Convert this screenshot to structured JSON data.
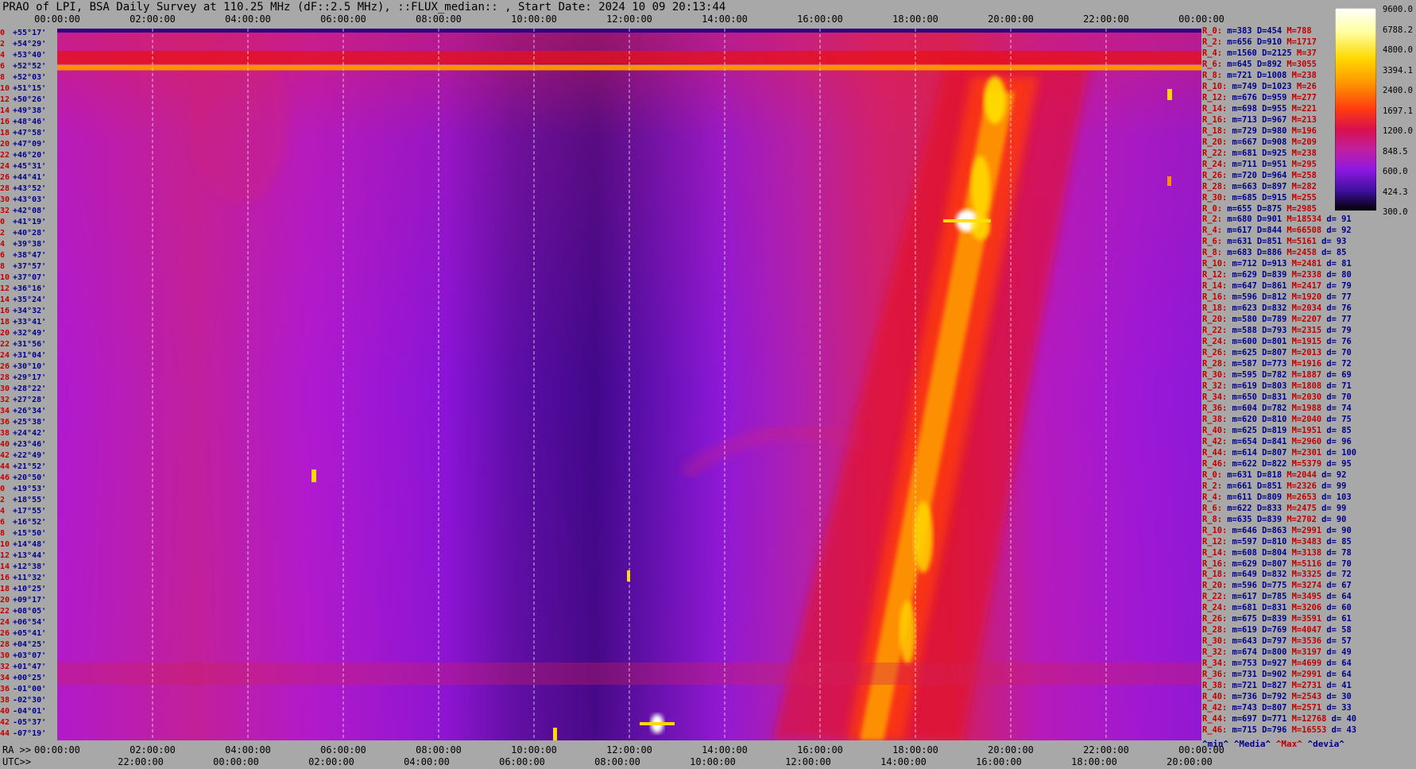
{
  "title": "PRAO of LPI, BSA Daily Survey at 110.25 MHz (dF::2.5 MHz), ::FLUX_median:: , Start Date: 2024 10 09 20:13:44",
  "chart_data": {
    "type": "heatmap",
    "title": "PRAO of LPI, BSA Daily Survey at 110.25 MHz (dF::2.5 MHz), ::FLUX_median:: , Start Date: 2024 10 09 20:13:44",
    "x_top_ticks": [
      "00:00:00",
      "02:00:00",
      "04:00:00",
      "06:00:00",
      "08:00:00",
      "10:00:00",
      "12:00:00",
      "14:00:00",
      "16:00:00",
      "18:00:00",
      "20:00:00",
      "22:00:00",
      "00:00:00"
    ],
    "x_bottom_ra_label": "RA >>",
    "x_bottom_ra_ticks": [
      "00:00:00",
      "02:00:00",
      "04:00:00",
      "06:00:00",
      "08:00:00",
      "10:00:00",
      "12:00:00",
      "14:00:00",
      "16:00:00",
      "18:00:00",
      "20:00:00",
      "22:00:00",
      "00:00:00"
    ],
    "x_bottom_utc_label": "UTC>>",
    "x_bottom_utc_ticks": [
      "22:00:00",
      "00:00:00",
      "02:00:00",
      "04:00:00",
      "06:00:00",
      "08:00:00",
      "10:00:00",
      "12:00:00",
      "14:00:00",
      "16:00:00",
      "18:00:00",
      "20:00:00"
    ],
    "y_rows": [
      {
        "n": "0",
        "dec": "+55°17'"
      },
      {
        "n": "2",
        "dec": "+54°29'"
      },
      {
        "n": "4",
        "dec": "+53°40'"
      },
      {
        "n": "6",
        "dec": "+52°52'"
      },
      {
        "n": "8",
        "dec": "+52°03'"
      },
      {
        "n": "10",
        "dec": "+51°15'"
      },
      {
        "n": "12",
        "dec": "+50°26'"
      },
      {
        "n": "14",
        "dec": "+49°38'"
      },
      {
        "n": "16",
        "dec": "+48°46'"
      },
      {
        "n": "18",
        "dec": "+47°58'"
      },
      {
        "n": "20",
        "dec": "+47°09'"
      },
      {
        "n": "22",
        "dec": "+46°20'"
      },
      {
        "n": "24",
        "dec": "+45°31'"
      },
      {
        "n": "26",
        "dec": "+44°41'"
      },
      {
        "n": "28",
        "dec": "+43°52'"
      },
      {
        "n": "30",
        "dec": "+43°03'"
      },
      {
        "n": "32",
        "dec": "+42°08'"
      },
      {
        "n": "0",
        "dec": "+41°19'"
      },
      {
        "n": "2",
        "dec": "+40°28'"
      },
      {
        "n": "4",
        "dec": "+39°38'"
      },
      {
        "n": "6",
        "dec": "+38°47'"
      },
      {
        "n": "8",
        "dec": "+37°57'"
      },
      {
        "n": "10",
        "dec": "+37°07'"
      },
      {
        "n": "12",
        "dec": "+36°16'"
      },
      {
        "n": "14",
        "dec": "+35°24'"
      },
      {
        "n": "16",
        "dec": "+34°32'"
      },
      {
        "n": "18",
        "dec": "+33°41'"
      },
      {
        "n": "20",
        "dec": "+32°49'"
      },
      {
        "n": "22",
        "dec": "+31°56'"
      },
      {
        "n": "24",
        "dec": "+31°04'"
      },
      {
        "n": "26",
        "dec": "+30°10'"
      },
      {
        "n": "28",
        "dec": "+29°17'"
      },
      {
        "n": "30",
        "dec": "+28°22'"
      },
      {
        "n": "32",
        "dec": "+27°28'"
      },
      {
        "n": "34",
        "dec": "+26°34'"
      },
      {
        "n": "36",
        "dec": "+25°38'"
      },
      {
        "n": "38",
        "dec": "+24°42'"
      },
      {
        "n": "40",
        "dec": "+23°46'"
      },
      {
        "n": "42",
        "dec": "+22°49'"
      },
      {
        "n": "44",
        "dec": "+21°52'"
      },
      {
        "n": "46",
        "dec": "+20°50'"
      },
      {
        "n": "0",
        "dec": "+19°53'"
      },
      {
        "n": "2",
        "dec": "+18°55'"
      },
      {
        "n": "4",
        "dec": "+17°55'"
      },
      {
        "n": "6",
        "dec": "+16°52'"
      },
      {
        "n": "8",
        "dec": "+15°50'"
      },
      {
        "n": "10",
        "dec": "+14°48'"
      },
      {
        "n": "12",
        "dec": "+13°44'"
      },
      {
        "n": "14",
        "dec": "+12°38'"
      },
      {
        "n": "16",
        "dec": "+11°32'"
      },
      {
        "n": "18",
        "dec": "+10°25'"
      },
      {
        "n": "20",
        "dec": "+09°17'"
      },
      {
        "n": "22",
        "dec": "+08°05'"
      },
      {
        "n": "24",
        "dec": "+06°54'"
      },
      {
        "n": "26",
        "dec": "+05°41'"
      },
      {
        "n": "28",
        "dec": "+04°25'"
      },
      {
        "n": "30",
        "dec": "+03°07'"
      },
      {
        "n": "32",
        "dec": "+01°47'"
      },
      {
        "n": "34",
        "dec": "+00°25'"
      },
      {
        "n": "36",
        "dec": "-01°00'"
      },
      {
        "n": "38",
        "dec": "-02°30'"
      },
      {
        "n": "40",
        "dec": "-04°01'"
      },
      {
        "n": "42",
        "dec": "-05°37'"
      },
      {
        "n": "44",
        "dec": "-07°19'"
      }
    ],
    "colorbar": {
      "ticks": [
        "9600.0",
        "6788.2",
        "4800.0",
        "3394.1",
        "2400.0",
        "1697.1",
        "1200.0",
        "848.5",
        "600.0",
        "424.3",
        "300.0"
      ],
      "colors": [
        "#ffffff",
        "#ffffa0",
        "#ffe000",
        "#ffa000",
        "#ff5000",
        "#e8101a",
        "#d0207a",
        "#a820d0",
        "#6a10e0",
        "#300080",
        "#000000"
      ]
    },
    "row_stats": [
      {
        "r": "R_0:",
        "m": "m=383",
        "d": "D=454",
        "x": "M=788",
        "dd": ""
      },
      {
        "r": "R_2:",
        "m": "m=656",
        "d": "D=910",
        "x": "M=1717",
        "dd": ""
      },
      {
        "r": "R_4:",
        "m": "m=1560",
        "d": "D=2125",
        "x": "M=37",
        "dd": ""
      },
      {
        "r": "R_6:",
        "m": "m=645",
        "d": "D=892",
        "x": "M=3055",
        "dd": ""
      },
      {
        "r": "R_8:",
        "m": "m=721",
        "d": "D=1008",
        "x": "M=238",
        "dd": ""
      },
      {
        "r": "R_10:",
        "m": "m=749",
        "d": "D=1023",
        "x": "M=26",
        "dd": ""
      },
      {
        "r": "R_12:",
        "m": "m=676",
        "d": "D=959",
        "x": "M=277",
        "dd": ""
      },
      {
        "r": "R_14:",
        "m": "m=698",
        "d": "D=955",
        "x": "M=221",
        "dd": ""
      },
      {
        "r": "R_16:",
        "m": "m=713",
        "d": "D=967",
        "x": "M=213",
        "dd": ""
      },
      {
        "r": "R_18:",
        "m": "m=729",
        "d": "D=980",
        "x": "M=196",
        "dd": ""
      },
      {
        "r": "R_20:",
        "m": "m=667",
        "d": "D=908",
        "x": "M=209",
        "dd": ""
      },
      {
        "r": "R_22:",
        "m": "m=681",
        "d": "D=925",
        "x": "M=238",
        "dd": ""
      },
      {
        "r": "R_24:",
        "m": "m=711",
        "d": "D=951",
        "x": "M=295",
        "dd": ""
      },
      {
        "r": "R_26:",
        "m": "m=720",
        "d": "D=964",
        "x": "M=258",
        "dd": ""
      },
      {
        "r": "R_28:",
        "m": "m=663",
        "d": "D=897",
        "x": "M=282",
        "dd": ""
      },
      {
        "r": "R_30:",
        "m": "m=685",
        "d": "D=915",
        "x": "M=255",
        "dd": ""
      },
      {
        "r": "R_0:",
        "m": "m=655",
        "d": "D=875",
        "x": "M=2985",
        "dd": ""
      },
      {
        "r": "R_2:",
        "m": "m=680",
        "d": "D=901",
        "x": "M=18534",
        "dd": "d= 91"
      },
      {
        "r": "R_4:",
        "m": "m=617",
        "d": "D=844",
        "x": "M=66508",
        "dd": "d= 92"
      },
      {
        "r": "R_6:",
        "m": "m=631",
        "d": "D=851",
        "x": "M=5161",
        "dd": "d= 93"
      },
      {
        "r": "R_8:",
        "m": "m=683",
        "d": "D=886",
        "x": "M=2458",
        "dd": "d= 85"
      },
      {
        "r": "R_10:",
        "m": "m=712",
        "d": "D=913",
        "x": "M=2481",
        "dd": "d= 81"
      },
      {
        "r": "R_12:",
        "m": "m=629",
        "d": "D=839",
        "x": "M=2338",
        "dd": "d= 80"
      },
      {
        "r": "R_14:",
        "m": "m=647",
        "d": "D=861",
        "x": "M=2417",
        "dd": "d= 79"
      },
      {
        "r": "R_16:",
        "m": "m=596",
        "d": "D=812",
        "x": "M=1920",
        "dd": "d= 77"
      },
      {
        "r": "R_18:",
        "m": "m=623",
        "d": "D=832",
        "x": "M=2034",
        "dd": "d= 76"
      },
      {
        "r": "R_20:",
        "m": "m=580",
        "d": "D=789",
        "x": "M=2207",
        "dd": "d= 77"
      },
      {
        "r": "R_22:",
        "m": "m=588",
        "d": "D=793",
        "x": "M=2315",
        "dd": "d= 79"
      },
      {
        "r": "R_24:",
        "m": "m=600",
        "d": "D=801",
        "x": "M=1915",
        "dd": "d= 76"
      },
      {
        "r": "R_26:",
        "m": "m=625",
        "d": "D=807",
        "x": "M=2013",
        "dd": "d= 70"
      },
      {
        "r": "R_28:",
        "m": "m=587",
        "d": "D=773",
        "x": "M=1916",
        "dd": "d= 72"
      },
      {
        "r": "R_30:",
        "m": "m=595",
        "d": "D=782",
        "x": "M=1887",
        "dd": "d= 69"
      },
      {
        "r": "R_32:",
        "m": "m=619",
        "d": "D=803",
        "x": "M=1808",
        "dd": "d= 71"
      },
      {
        "r": "R_34:",
        "m": "m=650",
        "d": "D=831",
        "x": "M=2030",
        "dd": "d= 70"
      },
      {
        "r": "R_36:",
        "m": "m=604",
        "d": "D=782",
        "x": "M=1988",
        "dd": "d= 74"
      },
      {
        "r": "R_38:",
        "m": "m=620",
        "d": "D=810",
        "x": "M=2040",
        "dd": "d= 75"
      },
      {
        "r": "R_40:",
        "m": "m=625",
        "d": "D=819",
        "x": "M=1951",
        "dd": "d= 85"
      },
      {
        "r": "R_42:",
        "m": "m=654",
        "d": "D=841",
        "x": "M=2960",
        "dd": "d= 96"
      },
      {
        "r": "R_44:",
        "m": "m=614",
        "d": "D=807",
        "x": "M=2301",
        "dd": "d= 100"
      },
      {
        "r": "R_46:",
        "m": "m=622",
        "d": "D=822",
        "x": "M=5379",
        "dd": "d= 95"
      },
      {
        "r": "R_0:",
        "m": "m=631",
        "d": "D=818",
        "x": "M=2044",
        "dd": "d= 92"
      },
      {
        "r": "R_2:",
        "m": "m=661",
        "d": "D=851",
        "x": "M=2326",
        "dd": "d= 99"
      },
      {
        "r": "R_4:",
        "m": "m=611",
        "d": "D=809",
        "x": "M=2653",
        "dd": "d= 103"
      },
      {
        "r": "R_6:",
        "m": "m=622",
        "d": "D=833",
        "x": "M=2475",
        "dd": "d= 99"
      },
      {
        "r": "R_8:",
        "m": "m=635",
        "d": "D=839",
        "x": "M=2702",
        "dd": "d= 90"
      },
      {
        "r": "R_10:",
        "m": "m=646",
        "d": "D=863",
        "x": "M=2991",
        "dd": "d= 90"
      },
      {
        "r": "R_12:",
        "m": "m=597",
        "d": "D=810",
        "x": "M=3483",
        "dd": "d= 85"
      },
      {
        "r": "R_14:",
        "m": "m=608",
        "d": "D=804",
        "x": "M=3138",
        "dd": "d= 78"
      },
      {
        "r": "R_16:",
        "m": "m=629",
        "d": "D=807",
        "x": "M=5116",
        "dd": "d= 70"
      },
      {
        "r": "R_18:",
        "m": "m=649",
        "d": "D=832",
        "x": "M=3325",
        "dd": "d= 72"
      },
      {
        "r": "R_20:",
        "m": "m=596",
        "d": "D=775",
        "x": "M=3274",
        "dd": "d= 67"
      },
      {
        "r": "R_22:",
        "m": "m=617",
        "d": "D=785",
        "x": "M=3495",
        "dd": "d= 64"
      },
      {
        "r": "R_24:",
        "m": "m=681",
        "d": "D=831",
        "x": "M=3206",
        "dd": "d= 60"
      },
      {
        "r": "R_26:",
        "m": "m=675",
        "d": "D=839",
        "x": "M=3591",
        "dd": "d= 61"
      },
      {
        "r": "R_28:",
        "m": "m=619",
        "d": "D=769",
        "x": "M=4047",
        "dd": "d= 58"
      },
      {
        "r": "R_30:",
        "m": "m=643",
        "d": "D=797",
        "x": "M=3536",
        "dd": "d= 57"
      },
      {
        "r": "R_32:",
        "m": "m=674",
        "d": "D=800",
        "x": "M=3197",
        "dd": "d= 49"
      },
      {
        "r": "R_34:",
        "m": "m=753",
        "d": "D=927",
        "x": "M=4699",
        "dd": "d= 64"
      },
      {
        "r": "R_36:",
        "m": "m=731",
        "d": "D=902",
        "x": "M=2991",
        "dd": "d= 64"
      },
      {
        "r": "R_38:",
        "m": "m=721",
        "d": "D=827",
        "x": "M=2731",
        "dd": "d= 41"
      },
      {
        "r": "R_40:",
        "m": "m=736",
        "d": "D=792",
        "x": "M=2543",
        "dd": "d= 30"
      },
      {
        "r": "R_42:",
        "m": "m=743",
        "d": "D=807",
        "x": "M=2571",
        "dd": "d= 33"
      },
      {
        "r": "R_44:",
        "m": "m=697",
        "d": "D=771",
        "x": "M=12768",
        "dd": "d= 40"
      },
      {
        "r": "R_46:",
        "m": "m=715",
        "d": "D=796",
        "x": "M=16553",
        "dd": "d= 43"
      }
    ],
    "footer": {
      "min": "^min^",
      "median": "^Media^",
      "max": "^Max^",
      "dev": "^devia^"
    }
  }
}
